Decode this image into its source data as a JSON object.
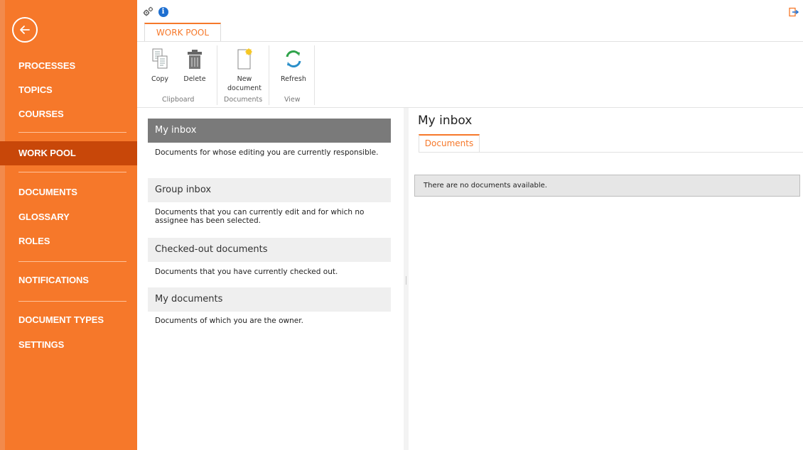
{
  "sidebar": {
    "back_icon": "arrow-left-circle-icon",
    "items": [
      {
        "label": "PROCESSES",
        "active": false
      },
      {
        "label": "TOPICS",
        "active": false
      },
      {
        "label": "COURSES",
        "active": false
      },
      {
        "label": "WORK POOL",
        "active": true
      },
      {
        "label": "DOCUMENTS",
        "active": false
      },
      {
        "label": "GLOSSARY",
        "active": false
      },
      {
        "label": "ROLES",
        "active": false
      },
      {
        "label": "NOTIFICATIONS",
        "active": false
      },
      {
        "label": "DOCUMENT TYPES",
        "active": false
      },
      {
        "label": "SETTINGS",
        "active": false
      }
    ]
  },
  "topbar": {
    "settings_icon": "gears-icon",
    "info_icon": "info-icon",
    "info_glyph": "i",
    "logout_icon": "exit-icon"
  },
  "ribbon": {
    "tab_label": "WORK POOL",
    "buttons": {
      "copy": "Copy",
      "delete": "Delete",
      "new_document_1": "New",
      "new_document_2": "document",
      "refresh": "Refresh"
    },
    "groups": {
      "clipboard": "Clipboard",
      "documents": "Documents",
      "view": "View"
    }
  },
  "inboxes": [
    {
      "title": "My inbox",
      "description": "Documents for whose editing you are currently responsible.",
      "active": true
    },
    {
      "title": "Group inbox",
      "description": "Documents that you can currently edit and for which no assignee has been selected.",
      "active": false
    },
    {
      "title": "Checked-out documents",
      "description": "Documents that you have currently checked out.",
      "active": false
    },
    {
      "title": "My documents",
      "description": "Documents of which you are the owner.",
      "active": false
    }
  ],
  "content": {
    "title": "My inbox",
    "tab_label": "Documents",
    "empty_message": "There are no documents available."
  },
  "colors": {
    "sidebar": "#f6782a",
    "sidebar_active": "#c84709",
    "accent": "#f6782a",
    "info": "#1e6fd0"
  }
}
